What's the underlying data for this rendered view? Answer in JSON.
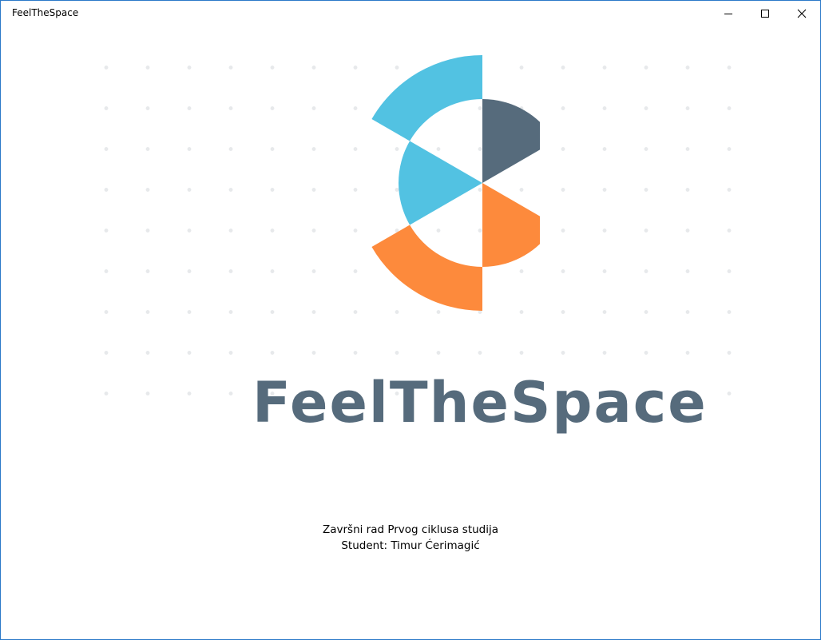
{
  "window": {
    "title": "FeelTheSpace",
    "border_color": "#2b79c9"
  },
  "titlebar_controls": {
    "minimize_icon": "minimize-icon",
    "maximize_icon": "maximize-icon",
    "close_icon": "close-icon"
  },
  "logo": {
    "wordmark": "FeelTheSpace",
    "colors": {
      "blue": "#52c2e2",
      "slate": "#566b7c",
      "orange": "#fd8a3c",
      "dots": "#e7e9eb"
    }
  },
  "footer": {
    "line1": "Završni rad Prvog ciklusa studija",
    "line2": "Student: Timur Ćerimagić"
  }
}
